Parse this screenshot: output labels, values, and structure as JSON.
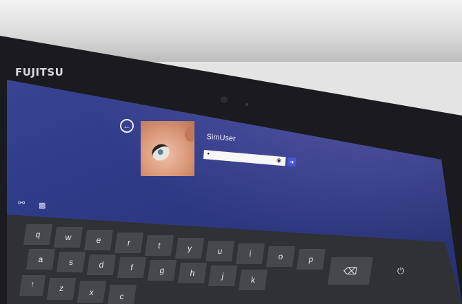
{
  "device": {
    "brand": "FUJITSU"
  },
  "lock_screen": {
    "username": "SimUser",
    "password_value": "•",
    "password_reveal_icon": "eye-icon",
    "submit_icon": "arrow-right-icon",
    "back_icon": "back-arrow-icon",
    "ease_of_access_icon": "ease-of-access-icon",
    "network_icon": "network-icon"
  },
  "keyboard": {
    "row1": [
      "q",
      "w",
      "e",
      "r",
      "t",
      "y",
      "u",
      "i",
      "o",
      "p"
    ],
    "row2": [
      "a",
      "s",
      "d",
      "f",
      "g",
      "h",
      "j",
      "k"
    ],
    "row3": [
      "↑",
      "z",
      "x",
      "c"
    ],
    "backspace_icon": "⌫",
    "power_icon": "⏻"
  },
  "colors": {
    "screen_blue": "#2e3b88",
    "accent": "#4a56d8",
    "keyboard": "#2f3134"
  }
}
